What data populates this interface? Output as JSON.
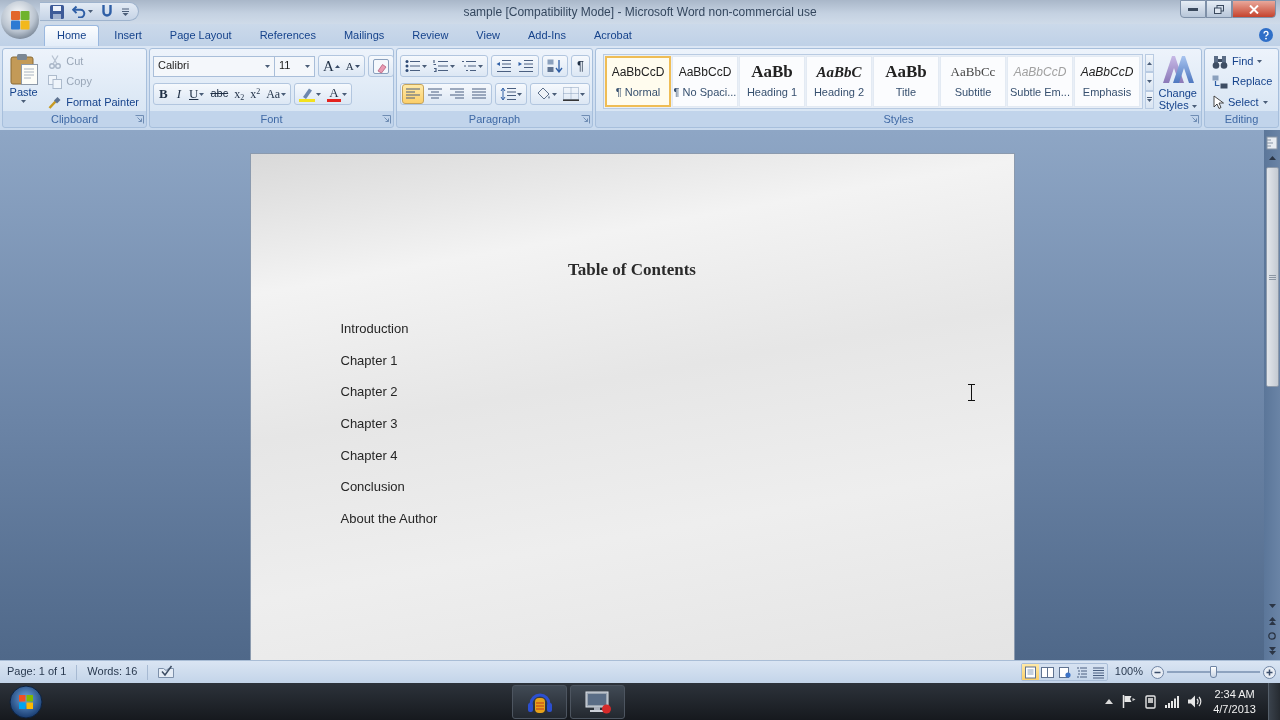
{
  "window": {
    "title": "sample [Compatibility Mode] - Microsoft Word non-commercial use"
  },
  "tabs": [
    {
      "label": "Home",
      "selected": true
    },
    {
      "label": "Insert",
      "selected": false
    },
    {
      "label": "Page Layout",
      "selected": false
    },
    {
      "label": "References",
      "selected": false
    },
    {
      "label": "Mailings",
      "selected": false
    },
    {
      "label": "Review",
      "selected": false
    },
    {
      "label": "View",
      "selected": false
    },
    {
      "label": "Add-Ins",
      "selected": false
    },
    {
      "label": "Acrobat",
      "selected": false
    }
  ],
  "ribbon": {
    "clipboard": {
      "label": "Clipboard",
      "paste": "Paste",
      "items": [
        {
          "label": "Cut",
          "disabled": true
        },
        {
          "label": "Copy",
          "disabled": true
        },
        {
          "label": "Format Painter",
          "disabled": false
        }
      ]
    },
    "font": {
      "label": "Font",
      "font_name": "Calibri",
      "font_size": "11",
      "grow": "A",
      "shrink": "A",
      "format_buttons": [
        {
          "label": "B",
          "kind": "bold"
        },
        {
          "label": "I",
          "kind": "italic"
        },
        {
          "label": "U",
          "kind": "underline"
        },
        {
          "label": "abc",
          "kind": "strike"
        },
        {
          "label": "x$_{2}$",
          "kind": "script"
        },
        {
          "label": "x$^{2}$",
          "kind": "script"
        },
        {
          "label": "Aa",
          "kind": "case"
        }
      ],
      "font_color": "A"
    },
    "paragraph": {
      "label": "Paragraph",
      "show_marks": "¶",
      "alignment": [
        {
          "selected": true
        },
        {
          "selected": false
        },
        {
          "selected": false
        },
        {
          "selected": false
        }
      ]
    },
    "styles": {
      "label": "Styles",
      "items": [
        {
          "preview": "AaBbCcD",
          "label": "¶ Normal",
          "kind": "body",
          "selected": true
        },
        {
          "preview": "AaBbCcD",
          "label": "¶ No Spaci...",
          "kind": "body",
          "selected": false
        },
        {
          "preview": "AaBb",
          "label": "Heading 1",
          "kind": "heading",
          "selected": false
        },
        {
          "preview": "AaBbC",
          "label": "Heading 2",
          "kind": "heading_italic",
          "selected": false
        },
        {
          "preview": "AaBb",
          "label": "Title",
          "kind": "heading",
          "selected": false
        },
        {
          "preview": "AaBbCc",
          "label": "Subtitle",
          "kind": "subtitle",
          "selected": false
        },
        {
          "preview": "AaBbCcD",
          "label": "Subtle Em...",
          "kind": "subtle",
          "selected": false
        },
        {
          "preview": "AaBbCcD",
          "label": "Emphasis",
          "kind": "emphasis",
          "selected": false
        }
      ],
      "change_styles": "Change Styles"
    },
    "editing": {
      "label": "Editing",
      "items": [
        {
          "label": "Find",
          "kind": "find",
          "menu": true
        },
        {
          "label": "Replace",
          "kind": "replace",
          "menu": false
        },
        {
          "label": "Select",
          "kind": "select",
          "menu": true
        }
      ]
    }
  },
  "document": {
    "title": "Table of Contents",
    "entries": [
      "Introduction",
      "Chapter 1",
      "Chapter 2",
      "Chapter 3",
      "Chapter 4",
      "Conclusion",
      "About the Author"
    ]
  },
  "status_bar": {
    "page": "Page: 1 of 1",
    "words": "Words: 16",
    "views": [
      {
        "selected": true
      },
      {
        "selected": false
      },
      {
        "selected": false
      },
      {
        "selected": false
      },
      {
        "selected": false
      }
    ],
    "zoom": "100%",
    "zoom_slider": {
      "level": 0.5
    }
  },
  "taskbar": {
    "time": "2:34 AM",
    "date": "4/7/2013"
  }
}
